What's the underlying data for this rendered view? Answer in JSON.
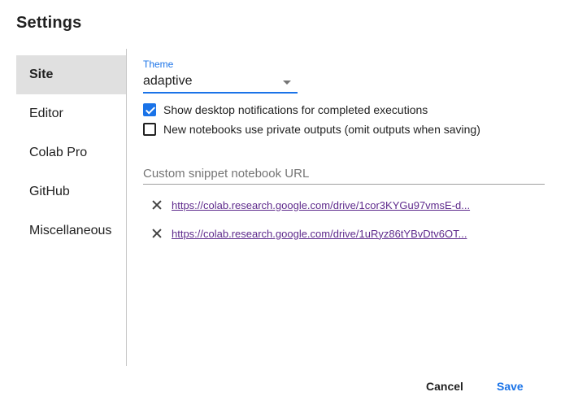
{
  "dialog": {
    "title": "Settings"
  },
  "sidebar": {
    "items": [
      {
        "label": "Site",
        "active": true
      },
      {
        "label": "Editor",
        "active": false
      },
      {
        "label": "Colab Pro",
        "active": false
      },
      {
        "label": "GitHub",
        "active": false
      },
      {
        "label": "Miscellaneous",
        "active": false
      }
    ]
  },
  "site": {
    "theme": {
      "label": "Theme",
      "value": "adaptive"
    },
    "checkboxes": [
      {
        "label": "Show desktop notifications for completed executions",
        "checked": true
      },
      {
        "label": "New notebooks use private outputs (omit outputs when saving)",
        "checked": false
      }
    ],
    "snippet_url": {
      "placeholder": "Custom snippet notebook URL",
      "value": ""
    },
    "snippets": [
      {
        "url": "https://colab.research.google.com/drive/1cor3KYGu97vmsE-d..."
      },
      {
        "url": "https://colab.research.google.com/drive/1uRyz86tYBvDtv6OT..."
      }
    ]
  },
  "footer": {
    "cancel_label": "Cancel",
    "save_label": "Save"
  },
  "colors": {
    "accent": "#1a73e8",
    "link": "#5e2a8c",
    "active_tab_bg": "#e0e0e0"
  }
}
